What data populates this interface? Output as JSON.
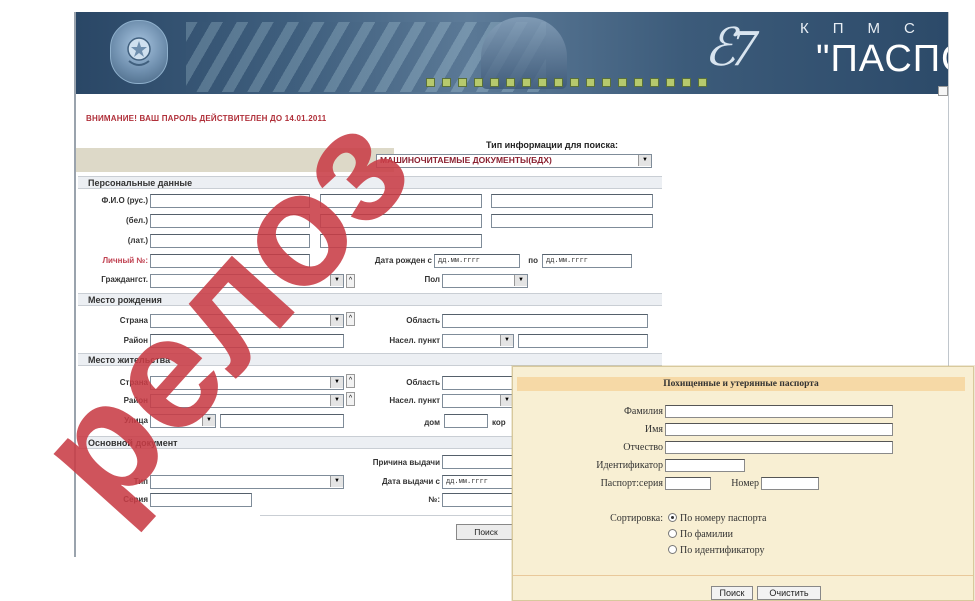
{
  "banner": {
    "brand_kpms": [
      "К",
      "П",
      "М",
      "С"
    ],
    "brand_name": "\"ПАСПОРТ\""
  },
  "warning": "ВНИМАНИЕ! ВАШ ПАРОЛЬ ДЕЙСТВИТЕЛЕН ДО 14.01.2011",
  "watermark": "релоз",
  "search": {
    "type_label": "Тип информации для поиска:",
    "type_value": "МАШИНОЧИТАЕМЫЕ ДОКУМЕНТЫ(БДХ)"
  },
  "personal": {
    "header": "Персональные данные",
    "fio_rus_label": "Ф.И.О (рус.)",
    "fio_bel_label": "(бел.)",
    "fio_lat_label": "(лат.)",
    "personal_no_label": "Личный №:",
    "birth_from_label": "Дата рожден с",
    "birth_from_placeholder": "дд.мм.гггг",
    "birth_to_label": "по",
    "birth_to_placeholder": "дд.мм.гггг",
    "citizenship_label": "Граждангст.",
    "sex_label": "Пол"
  },
  "birthplace": {
    "header": "Место рождения",
    "country_label": "Страна",
    "region_label": "Область",
    "district_label": "Район",
    "locality_label": "Насел. пункт"
  },
  "residence": {
    "header": "Место жительства",
    "country_label": "Страна",
    "region_label": "Область",
    "district_label": "Район",
    "locality_label": "Насел. пункт",
    "street_label": "Улица",
    "house_label": "дом",
    "building_label": "кор"
  },
  "document": {
    "header": "Основной документ",
    "reason_label": "Причина выдачи",
    "type_label": "Тип",
    "issue_date_label": "Дата выдачи с",
    "issue_date_placeholder": "дд.мм.гггг",
    "series_label": "Серия",
    "number_label": "№:"
  },
  "search_button": "Поиск",
  "lost_passports": {
    "title": "Похищенные и утерянные паспорта",
    "surname_label": "Фамилия",
    "name_label": "Имя",
    "patronymic_label": "Отчество",
    "identifier_label": "Идентификатор",
    "passport_series_label": "Паспорт:серия",
    "number_label": "Номер",
    "sort_label": "Сортировка:",
    "sort_options": [
      "По номеру паспорта",
      "По фамилии",
      "По идентификатору"
    ],
    "sort_selected": 0,
    "search_button": "Поиск",
    "clear_button": "Очистить"
  }
}
